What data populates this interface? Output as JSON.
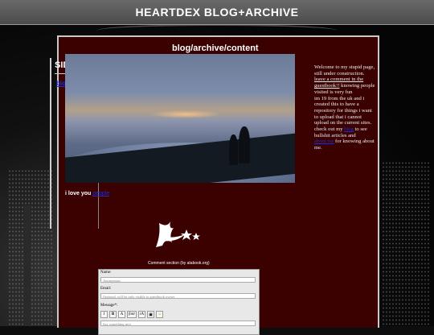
{
  "header": {
    "title": "HEARTDEX BLOG+ARCHIVE"
  },
  "sidebar": {
    "title": "SIDEBAR",
    "link": "blog"
  },
  "content": {
    "title": "blog/archive/content"
  },
  "intro": {
    "line1": "Welcome to my stupid page, still under construction.",
    "guestbook_link": "leave a comment in the guestbook!!",
    "line2": " knowing people visited is very fun",
    "line3": "im 19 from the uk and i created this to have a repository for things i want to upload that i cannot upload on the current sites.",
    "line4_prefix": "check out my ",
    "blog_link": "blog",
    "line4_suffix": " to see bullshit articles and",
    "about_link": "about me",
    "line5": " for knowing about me."
  },
  "love": {
    "text": "i love you ",
    "link": "people"
  },
  "guestbook": {
    "caption": "Comment section (by atabook.org)",
    "name_label": "Name:",
    "name_placeholder": "Anonymous",
    "email_label": "Email:",
    "email_placeholder": "Optional, will be only visible to guestbook owner",
    "message_label": "Message*:",
    "message_placeholder": "Say something nice",
    "tools": [
      "I",
      "B",
      "A",
      "font",
      "rA",
      "image-icon",
      "smiley-icon"
    ]
  }
}
